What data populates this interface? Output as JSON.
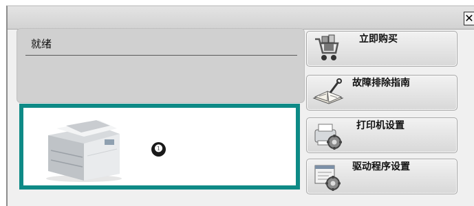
{
  "window": {
    "close_symbol": "✕"
  },
  "status": {
    "text": "就绪"
  },
  "printer_panel": {
    "callout_number": "❶"
  },
  "actions": [
    {
      "label": "立即购买",
      "icon": "shopping-cart-icon"
    },
    {
      "label": "故障排除指南",
      "icon": "troubleshooting-book-icon"
    },
    {
      "label": "打印机设置",
      "icon": "printer-settings-icon"
    },
    {
      "label": "驱动程序设置",
      "icon": "driver-settings-icon"
    }
  ],
  "colors": {
    "panel_border": "#0e8a86",
    "status_box": "#d0d0d0"
  }
}
